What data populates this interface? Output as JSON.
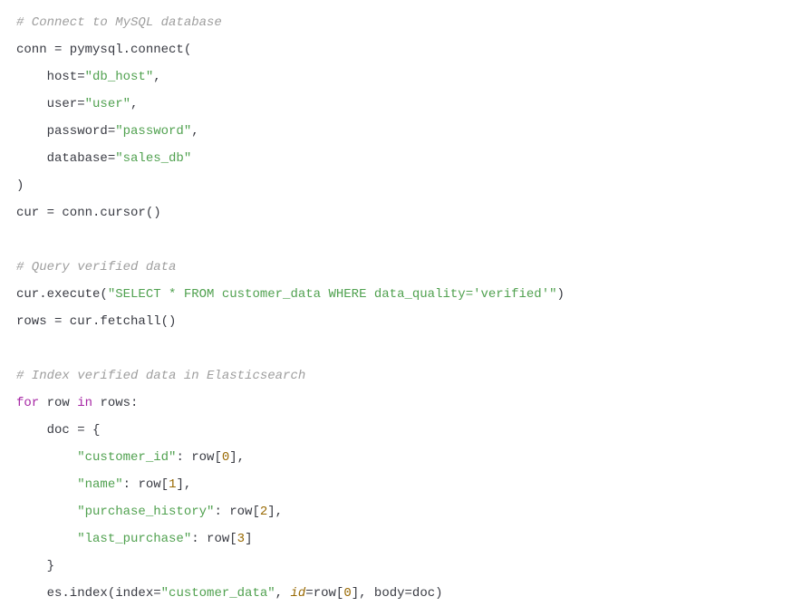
{
  "code": {
    "c1": "# Connect to MySQL database",
    "l2a": "conn = pymysql.connect(",
    "l3a": "    host=",
    "l3b": "\"db_host\"",
    "l3c": ",",
    "l4a": "    user=",
    "l4b": "\"user\"",
    "l4c": ",",
    "l5a": "    password=",
    "l5b": "\"password\"",
    "l5c": ",",
    "l6a": "    database=",
    "l6b": "\"sales_db\"",
    "l7a": ")",
    "l8a": "cur = conn.cursor()",
    "blank1": "",
    "c2": "# Query verified data",
    "l10a": "cur.execute(",
    "l10b": "\"SELECT * FROM customer_data WHERE data_quality='verified'\"",
    "l10c": ")",
    "l11a": "rows = cur.fetchall()",
    "blank2": "",
    "c3": "# Index verified data in Elasticsearch",
    "l13a": "for",
    "l13b": " row ",
    "l13c": "in",
    "l13d": " rows:",
    "l14a": "    doc = {",
    "l15a": "        ",
    "l15b": "\"customer_id\"",
    "l15c": ": row[",
    "l15d": "0",
    "l15e": "],",
    "l16a": "        ",
    "l16b": "\"name\"",
    "l16c": ": row[",
    "l16d": "1",
    "l16e": "],",
    "l17a": "        ",
    "l17b": "\"purchase_history\"",
    "l17c": ": row[",
    "l17d": "2",
    "l17e": "],",
    "l18a": "        ",
    "l18b": "\"last_purchase\"",
    "l18c": ": row[",
    "l18d": "3",
    "l18e": "]",
    "l19a": "    }",
    "l20a": "    es.index(index=",
    "l20b": "\"customer_data\"",
    "l20c": ", ",
    "l20d": "id",
    "l20e": "=row[",
    "l20f": "0",
    "l20g": "], body=doc)"
  }
}
